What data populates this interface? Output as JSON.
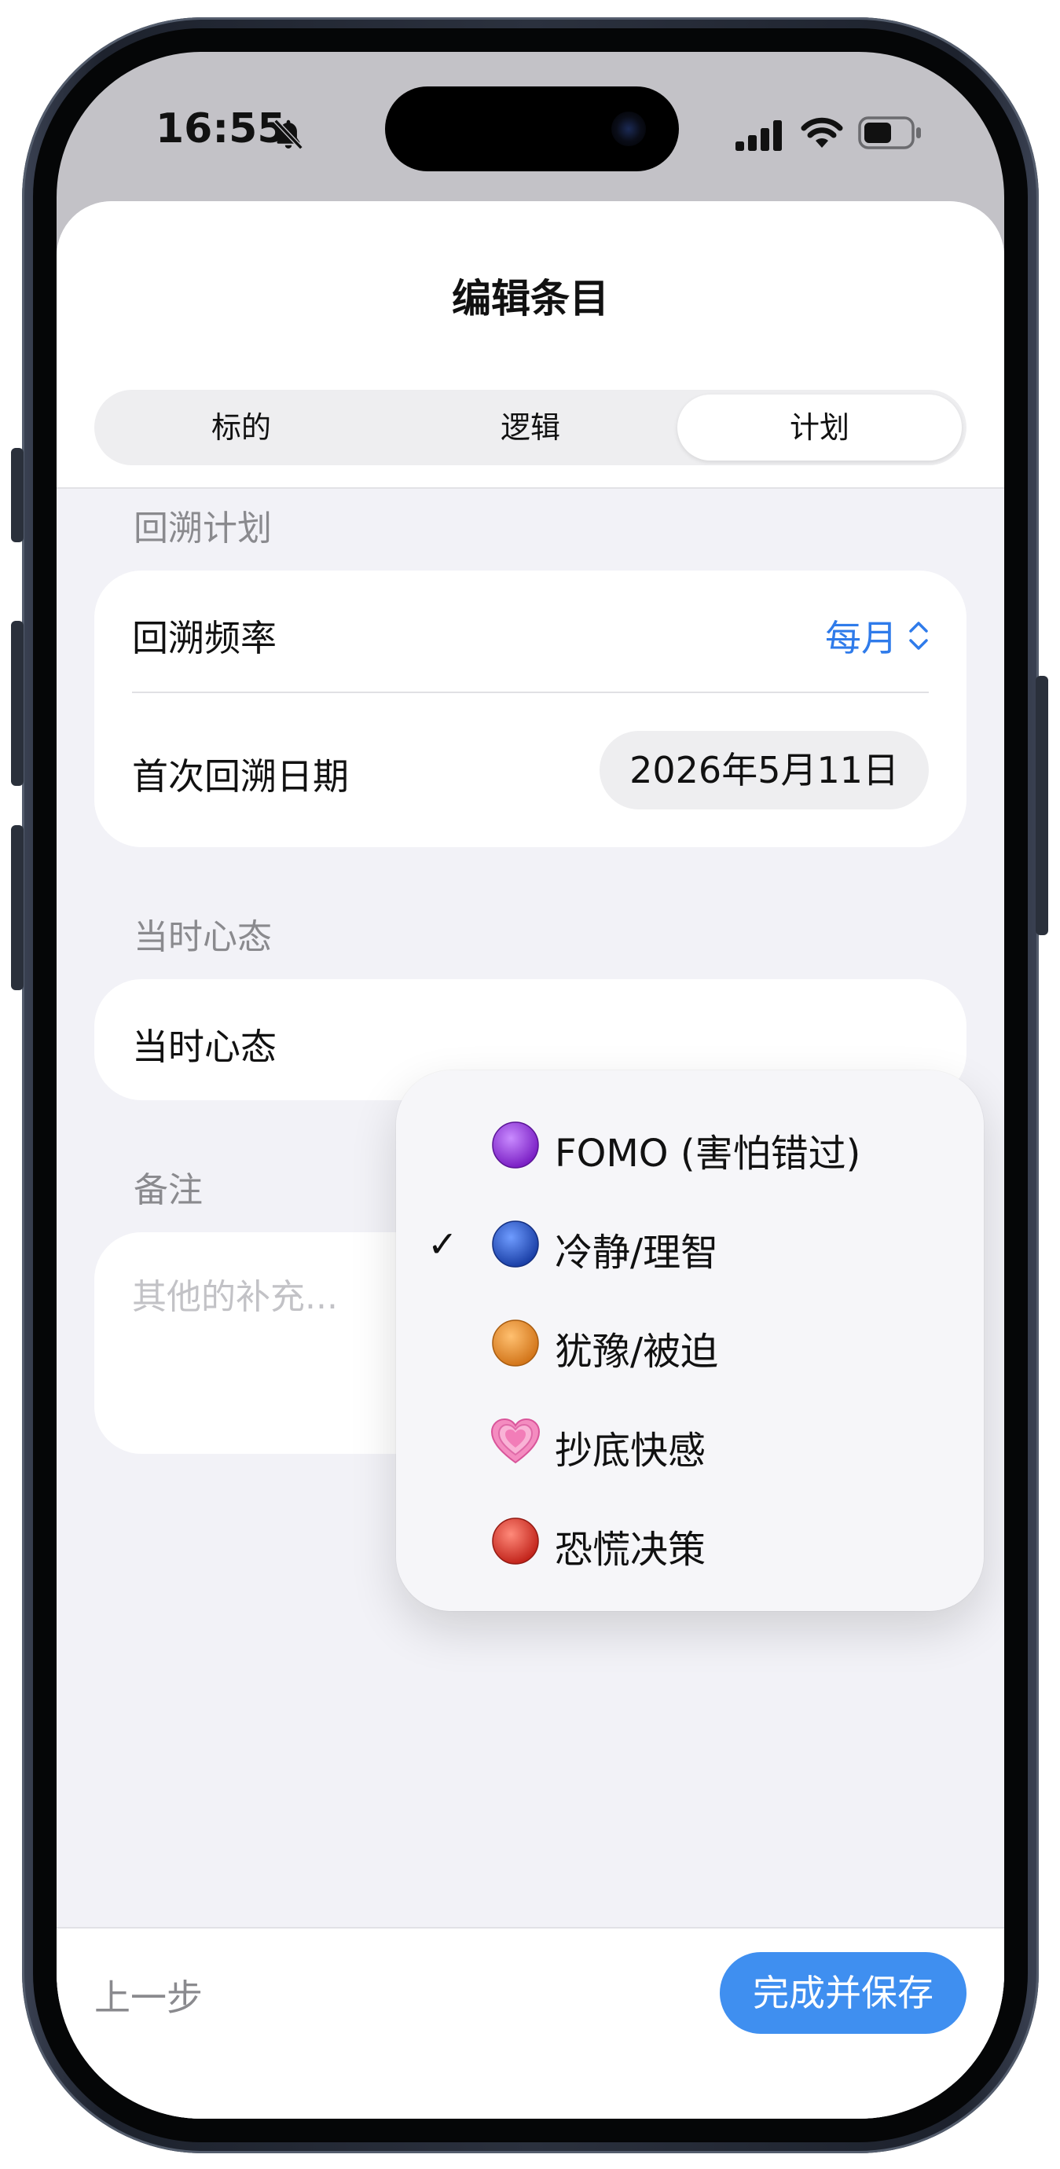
{
  "status_bar": {
    "time": "16:55",
    "battery_level": 0.6
  },
  "sheet": {
    "title": "编辑条目",
    "tabs": [
      {
        "label": "标的",
        "active": false
      },
      {
        "label": "逻辑",
        "active": false
      },
      {
        "label": "计划",
        "active": true
      }
    ]
  },
  "review_plan": {
    "section_title": "回溯计划",
    "frequency_label": "回溯频率",
    "frequency_value": "每月",
    "first_date_label": "首次回溯日期",
    "first_date_value": "2026年5月11日"
  },
  "mindset": {
    "section_title": "当时心态",
    "field_label": "当时心态",
    "options": [
      {
        "label": "FOMO (害怕错过)",
        "icon": "purple-circle-icon",
        "color": "#9b3fe0",
        "selected": false
      },
      {
        "label": "冷静/理智",
        "icon": "blue-circle-icon",
        "color": "#2558c9",
        "selected": true
      },
      {
        "label": "犹豫/被迫",
        "icon": "orange-circle-icon",
        "color": "#e08a2a",
        "selected": false
      },
      {
        "label": "抄底快感",
        "icon": "growing-heart-icon",
        "color": "#f07cb4",
        "selected": false
      },
      {
        "label": "恐慌决策",
        "icon": "red-circle-icon",
        "color": "#d93a2e",
        "selected": false
      }
    ]
  },
  "notes": {
    "section_title": "备注",
    "placeholder": "其他的补充..."
  },
  "footer": {
    "back_label": "上一步",
    "save_label": "完成并保存"
  },
  "colors": {
    "accent": "#2f7bea",
    "button": "#3f8ff0",
    "background": "#f2f2f7"
  }
}
